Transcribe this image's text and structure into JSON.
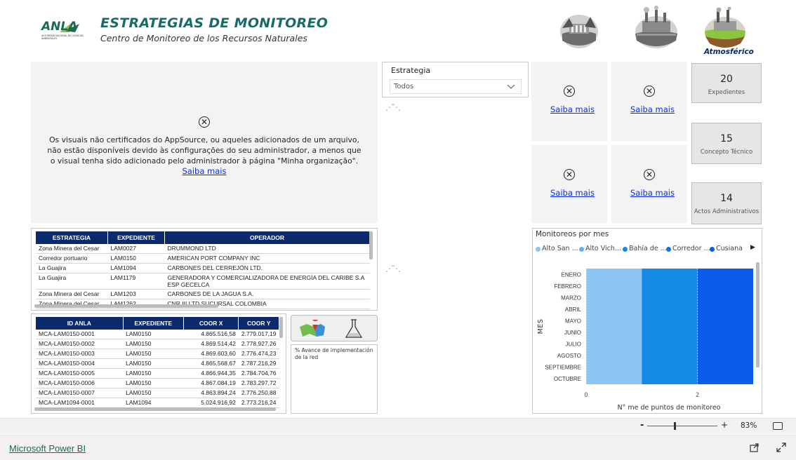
{
  "header": {
    "logo_text": "ANLA",
    "logo_subtext": "AUTORIDAD NACIONAL DE LICENCIAS AMBIENTALES",
    "title": "ESTRATEGIAS DE MONITOREO",
    "subtitle": "Centro de Monitoreo de los Recursos Naturales",
    "category_label": "Atmosférico"
  },
  "notice": {
    "text": "Os visuais não certificados do AppSource, ou aqueles adicionados de um arquivo, não estão disponíveis devido às configurações do seu administrador, a menos que o visual tenha sido adicionado pelo administrador à página \"Minha organização\".",
    "link": "Saiba mais"
  },
  "slicer": {
    "label": "Estrategia",
    "value": "Todos"
  },
  "small_visuals": {
    "link": "Saiba mais"
  },
  "cards": [
    {
      "value": "20",
      "label": "Expedientes"
    },
    {
      "value": "15",
      "label": "Concepto Técnico"
    },
    {
      "value": "14",
      "label": "Actos Administrativos"
    }
  ],
  "table1": {
    "headers": [
      "ESTRATEGIA",
      "EXPEDIENTE",
      "OPERADOR"
    ],
    "rows": [
      [
        "Zona Minera del Cesar",
        "LAM0027",
        "DRUMMOND LTD"
      ],
      [
        "Corredor portuario",
        "LAM0150",
        "AMERICAN PORT COMPANY INC"
      ],
      [
        "La Guajira",
        "LAM1094",
        "CARBONES DEL CERREJÓN LTD."
      ],
      [
        "La Guajira",
        "LAM1179",
        "GENERADORA Y COMERCIALIZADORA DE ENERGÍA DEL CARIBE S.A ESP GECELCA"
      ],
      [
        "Zona Minera del Cesar",
        "LAM1203",
        "CARBONES DE LA JAGUA S.A."
      ],
      [
        "Zona Minera del Cesar",
        "LAM1262",
        "CNR III LTD SUCURSAL COLOMBIA"
      ]
    ]
  },
  "table2": {
    "headers": [
      "ID ANLA",
      "EXPEDIENTE",
      "COOR X",
      "COOR Y"
    ],
    "rows": [
      [
        "MCA-LAM0150-0001",
        "LAM0150",
        "4.865.516,58",
        "2.779.017,19"
      ],
      [
        "MCA-LAM0150-0002",
        "LAM0150",
        "4.869.514,42",
        "2.778.927,26"
      ],
      [
        "MCA-LAM0150-0003",
        "LAM0150",
        "4.869.603,60",
        "2.776.474,23"
      ],
      [
        "MCA-LAM0150-0004",
        "LAM0150",
        "4.865.568,67",
        "2.787.216,29"
      ],
      [
        "MCA-LAM0150-0005",
        "LAM0150",
        "4.866.944,35",
        "2.784.704,76"
      ],
      [
        "MCA-LAM0150-0006",
        "LAM0150",
        "4.867.084,19",
        "2.783.297,72"
      ],
      [
        "MCA-LAM0150-0007",
        "LAM0150",
        "4.863.894,24",
        "2.776.250,88"
      ],
      [
        "MCA-LAM1094-0001",
        "LAM1094",
        "5.024.916,92",
        "2.773.216,24"
      ]
    ]
  },
  "progress_visual": {
    "label": "% Avance de implementación de la red"
  },
  "chart_data": {
    "type": "bar",
    "orientation": "horizontal",
    "stacked": true,
    "title": "Monitoreos por mes",
    "xlabel": "N° me de puntos de monitoreo",
    "ylabel": "MES",
    "categories": [
      "ENERO",
      "FEBRERO",
      "MARZO",
      "ABRIL",
      "MAYO",
      "JUNIO",
      "JULIO",
      "AGOSTO",
      "SEPTIEMBRE",
      "OCTUBRE"
    ],
    "legend_items": [
      "Alto San ...",
      "Alto Vich...",
      "Bahía de ...",
      "Corredor ...",
      "Cusiana"
    ],
    "series": [
      {
        "name": "Alto San ...",
        "color": "#8cc4f2",
        "values": [
          1,
          1,
          1,
          1,
          1,
          1,
          1,
          1,
          1,
          1
        ]
      },
      {
        "name": "Bahía de ...",
        "color": "#128ae6",
        "values": [
          1,
          1,
          1,
          1,
          1,
          1,
          1,
          1,
          1,
          1
        ]
      },
      {
        "name": "Cusiana",
        "color": "#0a5ced",
        "values": [
          1,
          1,
          1,
          1,
          1,
          1,
          1,
          1,
          1,
          1
        ]
      }
    ],
    "xlim": [
      0,
      3
    ],
    "xticks": [
      "0",
      "2"
    ],
    "legend_position": "top"
  },
  "zoom": {
    "value": "83%",
    "minus": "-",
    "plus": "+"
  },
  "footer": {
    "brand": "Microsoft Power BI"
  }
}
